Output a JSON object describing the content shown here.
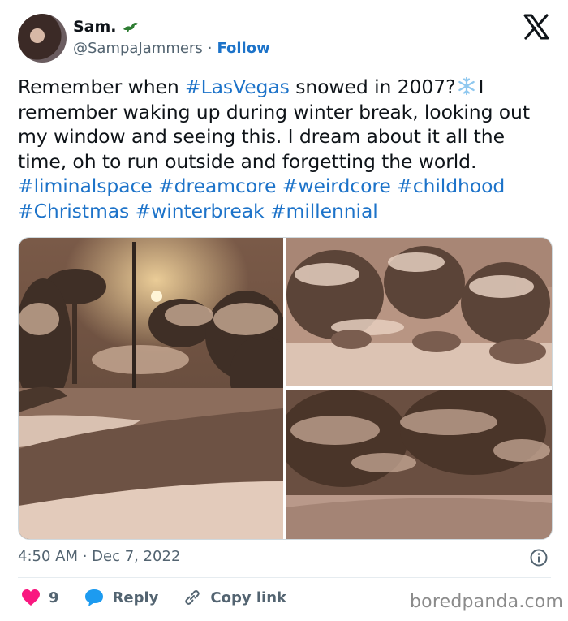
{
  "author": {
    "display_name": "Sam.",
    "handle": "@SampaJammers",
    "separator": "·",
    "follow_label": "Follow"
  },
  "tweet": {
    "seg1": "Remember when ",
    "tag_lasvegas": "#LasVegas",
    "seg2": " snowed in 2007?",
    "emoji": "❄️",
    "seg3": "I remember waking up during winter break, looking out my window and seeing this. I dream about it all the time, oh to run outside and forgetting the world. ",
    "tags": [
      "#liminalspace",
      "#dreamcore",
      "#weirdcore",
      "#childhood",
      "#Christmas",
      "#winterbreak",
      "#millennial"
    ]
  },
  "meta": {
    "timestamp": "4:50 AM · Dec 7, 2022"
  },
  "actions": {
    "like_count": "9",
    "reply_label": "Reply",
    "copy_link_label": "Copy link"
  },
  "watermark": "boredpanda.com",
  "colors": {
    "link": "#1d73c9",
    "heart": "#f91880",
    "reply_bubble": "#1d9bf0",
    "secondary_text": "#536471"
  },
  "icons": [
    "dinosaur-icon",
    "x-logo-icon",
    "snowflake-icon",
    "info-icon",
    "heart-icon",
    "reply-icon",
    "link-icon"
  ]
}
